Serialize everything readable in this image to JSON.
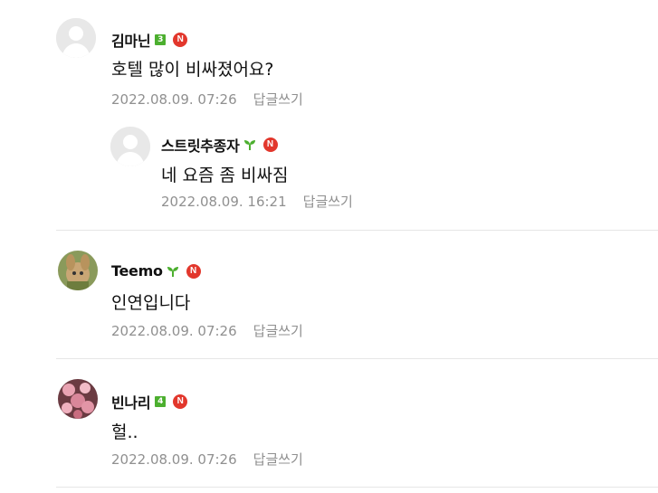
{
  "comments": [
    {
      "author": "김마닌",
      "level": "3",
      "text": "호텔 많이 비싸졌어요?",
      "date": "2022.08.09. 07:26",
      "reply_label": "답글쓰기"
    },
    {
      "author": "스트릿추종자",
      "text": "네 요즘 좀 비싸짐",
      "date": "2022.08.09. 16:21",
      "reply_label": "답글쓰기"
    },
    {
      "author": "Teemo",
      "text": "인연입니다",
      "date": "2022.08.09. 07:26",
      "reply_label": "답글쓰기"
    },
    {
      "author": "빈나리",
      "level": "4",
      "text": "헐..",
      "date": "2022.08.09. 07:26",
      "reply_label": "답글쓰기"
    }
  ],
  "badge_letter": "N",
  "colors": {
    "new_badge": "#e2372c",
    "level_badge": "#4caf2f",
    "meta_text": "#909090"
  },
  "icons": [
    "default-avatar-icon",
    "level-badge-icon",
    "sprout-icon",
    "new-badge-icon"
  ]
}
